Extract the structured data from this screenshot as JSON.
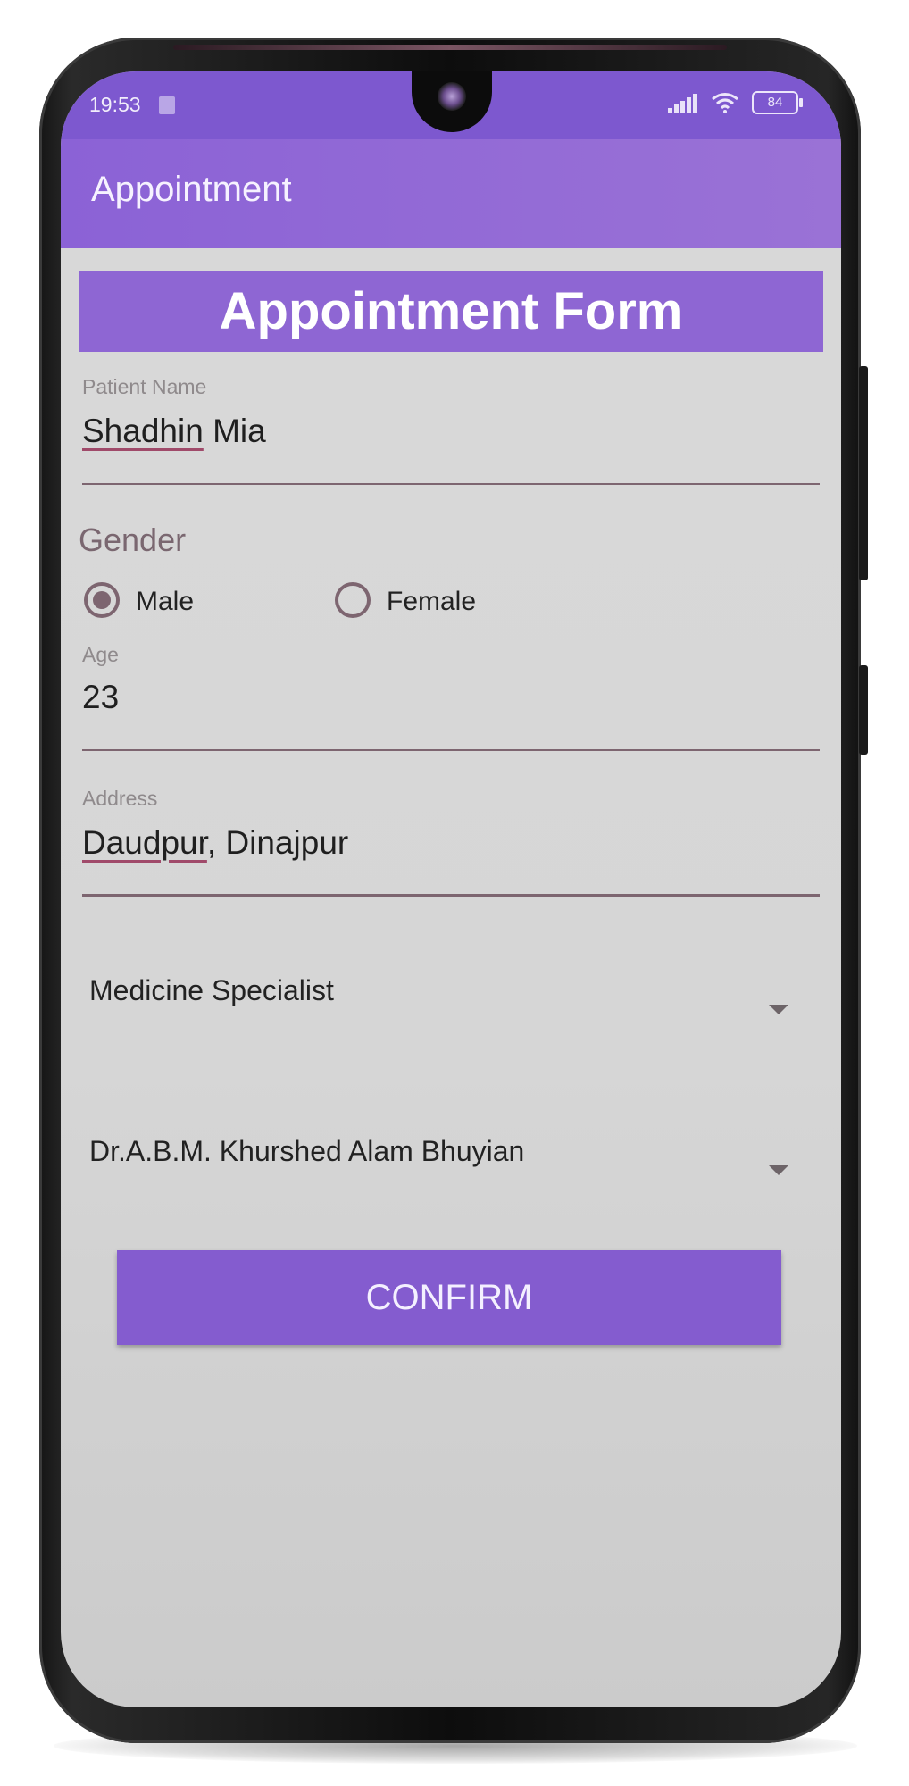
{
  "status_bar": {
    "time": "19:53",
    "battery": "84",
    "icons": [
      "sd-card-icon",
      "signal-icon",
      "wifi-icon",
      "battery-icon"
    ]
  },
  "app_bar": {
    "title": "Appointment"
  },
  "form": {
    "header": "Appointment Form",
    "patient_name": {
      "label": "Patient Name",
      "value_first": "Shadhin",
      "value_rest": " Mia"
    },
    "gender": {
      "title": "Gender",
      "options": [
        {
          "label": "Male",
          "checked": true
        },
        {
          "label": "Female",
          "checked": false
        }
      ]
    },
    "age": {
      "label": "Age",
      "value": "23"
    },
    "address": {
      "label": "Address",
      "value_first": "Daudpur",
      "value_rest": ", Dinajpur"
    },
    "specialty_select": {
      "selected": "Medicine Specialist"
    },
    "doctor_select": {
      "selected": "Dr.A.B.M. Khurshed Alam Bhuyian"
    },
    "confirm_label": "CONFIRM"
  },
  "colors": {
    "status_bar": "#7d58cf",
    "app_bar": "#8b62d6",
    "header_banner": "#8e66d3",
    "button": "#845ccf",
    "underline": "#7d6570"
  }
}
